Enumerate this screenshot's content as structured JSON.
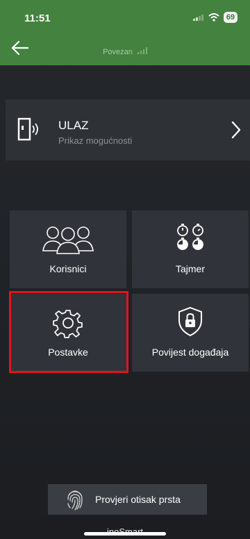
{
  "status": {
    "time": "11:51",
    "battery": "69"
  },
  "header": {
    "connection": "Povezan"
  },
  "entry": {
    "title": "ULAZ",
    "subtitle": "Prikaz mogućnosti"
  },
  "tiles": [
    {
      "label": "Korisnici",
      "icon": "users-icon"
    },
    {
      "label": "Tajmer",
      "icon": "timers-icon"
    },
    {
      "label": "Postavke",
      "icon": "gear-icon"
    },
    {
      "label": "Povijest događaja",
      "icon": "shield-lock-icon"
    }
  ],
  "fingerprint": {
    "label": "Provjeri otisak prsta"
  },
  "footer": {
    "brand": "inoSmart"
  },
  "colors": {
    "header_green": "#43833f",
    "highlight": "#e3141a",
    "tile_bg": "#30343a"
  }
}
